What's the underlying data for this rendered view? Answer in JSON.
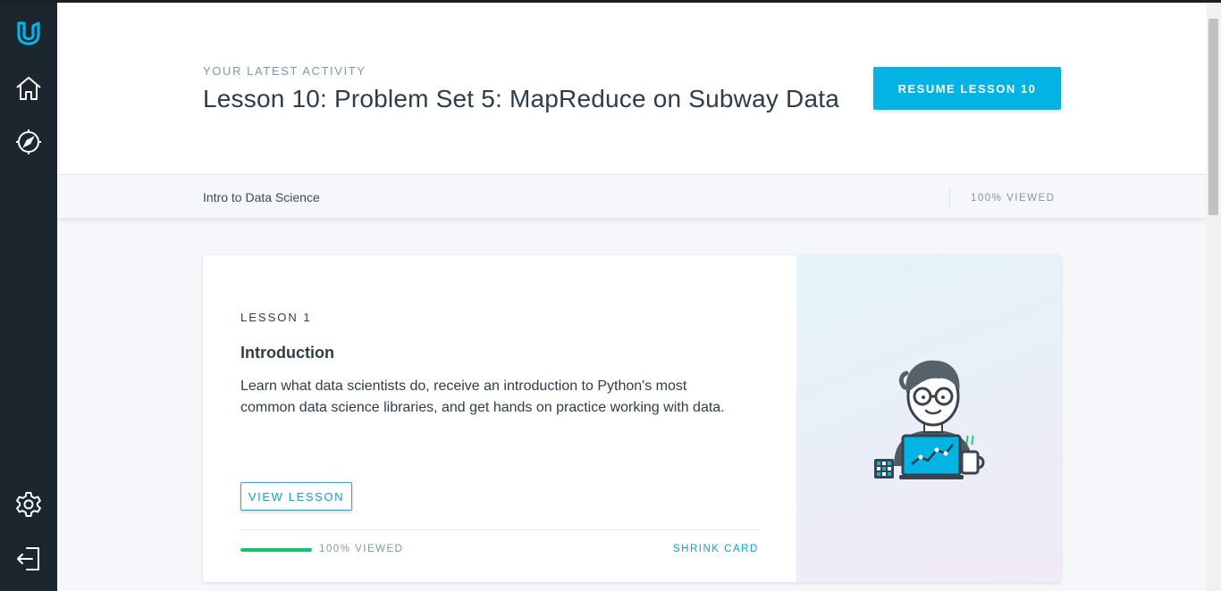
{
  "sidebar": {
    "items": [
      {
        "name": "udacity-logo",
        "icon": "udacity-logo-icon"
      },
      {
        "name": "home",
        "icon": "home-icon"
      },
      {
        "name": "explore",
        "icon": "compass-icon"
      },
      {
        "name": "settings",
        "icon": "gear-icon"
      },
      {
        "name": "logout",
        "icon": "logout-icon"
      }
    ]
  },
  "header": {
    "eyebrow": "YOUR LATEST ACTIVITY",
    "title": "Lesson 10: Problem Set 5: MapReduce on Subway Data",
    "resume_label": "RESUME LESSON 10"
  },
  "subbar": {
    "course": "Intro to Data Science",
    "viewed": "100% VIEWED"
  },
  "card": {
    "lesson_number": "LESSON 1",
    "lesson_title": "Introduction",
    "description": "Learn what data scientists do, receive an introduction to Python's most common data science libraries, and get hands on practice working with data.",
    "view_label": "VIEW LESSON",
    "progress": 1.0,
    "viewed": "100% VIEWED",
    "shrink_label": "SHRINK CARD"
  },
  "colors": {
    "accent": "#02b3e4",
    "sidebar": "#1c262f",
    "progress": "#15c26b",
    "icon": "#02b3e4"
  }
}
